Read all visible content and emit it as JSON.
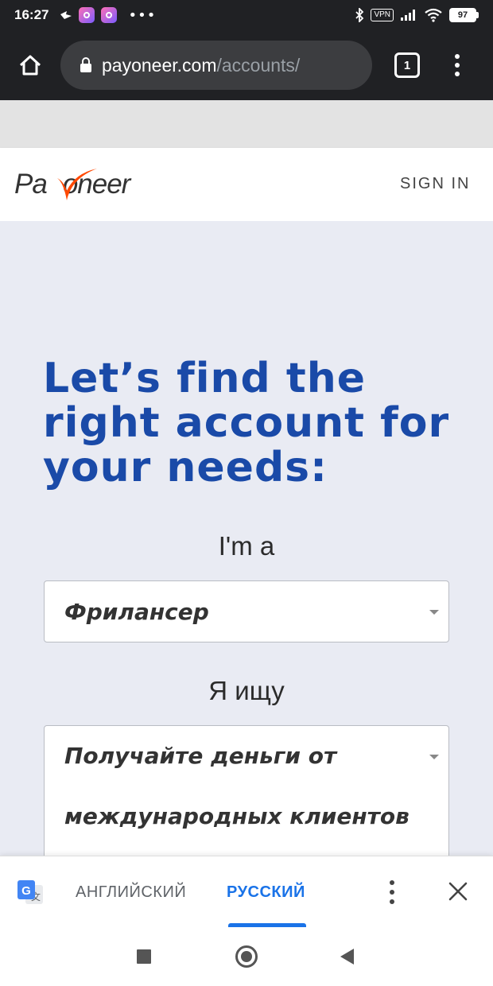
{
  "status_bar": {
    "time": "16:27",
    "vpn_label": "VPN",
    "battery": "97"
  },
  "browser": {
    "url_host": "payoneer.com",
    "url_path": "/accounts/",
    "tab_count": "1"
  },
  "site_header": {
    "logo_text_left": "Pa",
    "logo_text_right": "oneer",
    "sign_in": "SIGN IN"
  },
  "main": {
    "headline": "Let’s find the right account for your needs:",
    "label_role": "I'm a",
    "role_value": "Фрилансер",
    "label_looking": "Я ищу",
    "looking_value": "Получайте деньги от международных клиентов"
  },
  "translate_bar": {
    "lang_source": "АНГЛИЙСКИЙ",
    "lang_target": "РУССКИЙ"
  },
  "colors": {
    "brand_blue": "#1a4aa8",
    "logo_orange": "#ff4800",
    "translate_accent": "#1a73e8"
  }
}
